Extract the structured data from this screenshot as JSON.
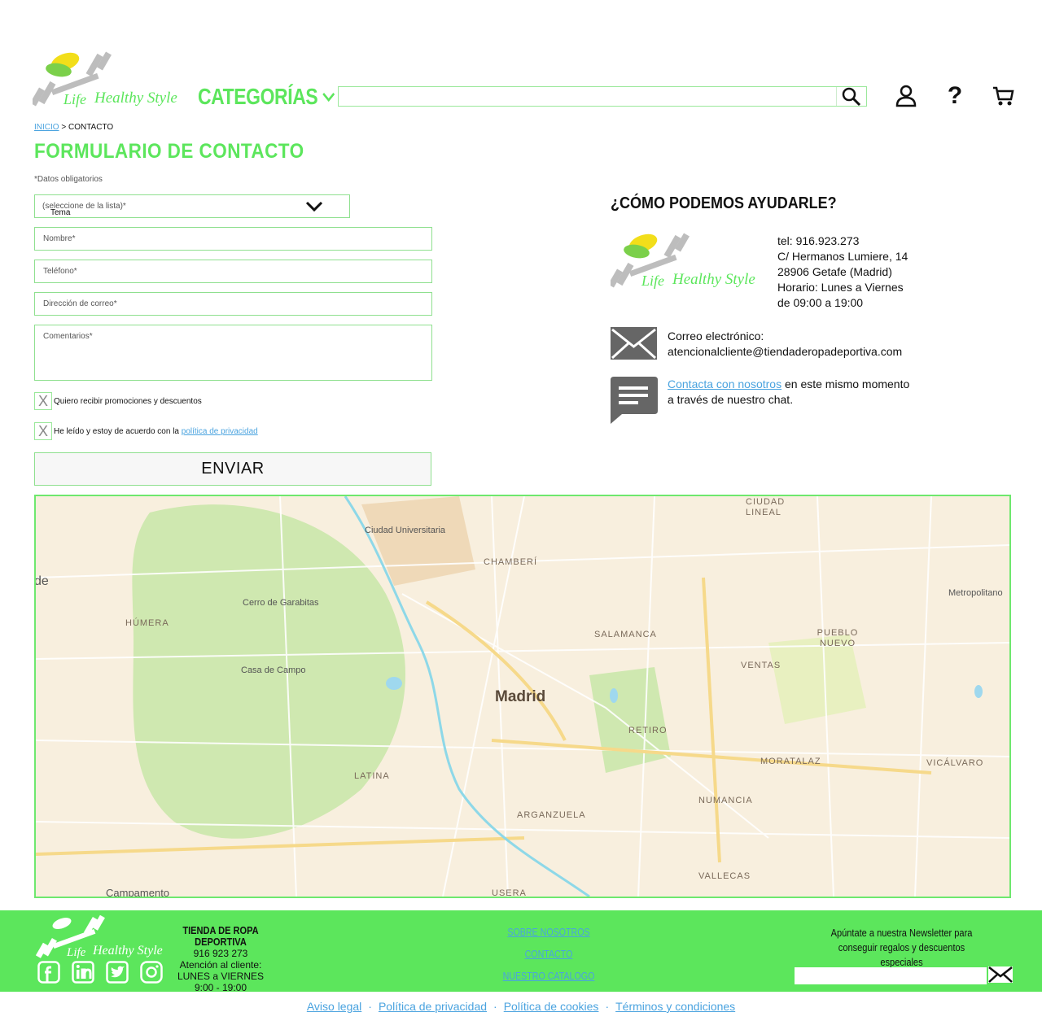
{
  "brand": {
    "logo_line1": "Life",
    "logo_line2": "Healthy Style"
  },
  "header": {
    "categories_label": "CATEGORÍAS",
    "search_placeholder": ""
  },
  "breadcrumb": {
    "home": "INICIO",
    "separator": ">",
    "current": "CONTACTO"
  },
  "form": {
    "title": "FORMULARIO DE CONTACTO",
    "required_note": "*Datos obligatorios",
    "topic_label": "Tema",
    "topic_hint": "(seleccione de la lista)*",
    "name_label": "Nombre*",
    "phone_label": "Teléfono*",
    "email_label": "Dirección de correo*",
    "comments_label": "Comentarios*",
    "promo_check": "X",
    "promo_label": "Quiero recibir promociones y descuentos",
    "privacy_check": "X",
    "privacy_label": "He leído y estoy de acuerdo con la",
    "privacy_link": "política de privacidad",
    "send_label": "ENVIAR"
  },
  "help": {
    "title": "¿CÓMO PODEMOS AYUDARLE?",
    "phone": "tel: 916.923.273",
    "address1": "C/ Hermanos Lumiere, 14",
    "address2": "28906 Getafe (Madrid)",
    "hours1": "Horario: Lunes a Viernes",
    "hours2": "de 09:00 a 19:00",
    "email_label": "Correo electrónico:",
    "email": "atencionalcliente@tiendaderopadeportiva.com",
    "chat_link": "Contacta con nosotros",
    "chat_rest1": " en este mismo momento",
    "chat_rest2": "a través de nuestro chat."
  },
  "map": {
    "labels": {
      "madrid": "Madrid",
      "ciudad_universitaria": "Ciudad Universitaria",
      "chamberi": "CHAMBERÍ",
      "ciudad_lineal": "CIUDAD LINEAL",
      "cerro": "Cerro de Garabitas",
      "humera": "HÚMERA",
      "casa_campo": "Casa de Campo",
      "salamanca": "SALAMANCA",
      "pueblo_nuevo": "PUEBLO NUEVO",
      "ventas": "VENTAS",
      "retiro": "RETIRO",
      "moratalaz": "MORATALAZ",
      "vicalvaro": "VICÁLVARO",
      "latina": "LATINA",
      "numancia": "NUMANCIA",
      "arganzuela": "ARGANZUELA",
      "vallecas": "VALLECAS",
      "usera": "USERA",
      "campamento": "Campamento",
      "metropolitano": "Metropolitano",
      "edge": "de"
    }
  },
  "footer": {
    "store_title": "TIENDA DE ROPA DEPORTIVA",
    "store_phone": "916 923 273",
    "store_attention": "Atención al cliente:",
    "store_days": "LUNES a VIERNES",
    "store_hours": "9:00 - 19:00",
    "links": [
      "SOBRE NOSOTROS",
      "CONTACTO",
      "NUESTRO CATALOGO"
    ],
    "newsletter_text": "Apúntate a nuestra Newsletter para conseguir regalos y descuentos especiales",
    "legal": [
      "Aviso legal",
      "Política de privacidad",
      "Política de cookies",
      "Términos y condiciones"
    ],
    "legal_sep": "·"
  },
  "colors": {
    "accent": "#5ce65c",
    "link": "#4aa3df"
  }
}
